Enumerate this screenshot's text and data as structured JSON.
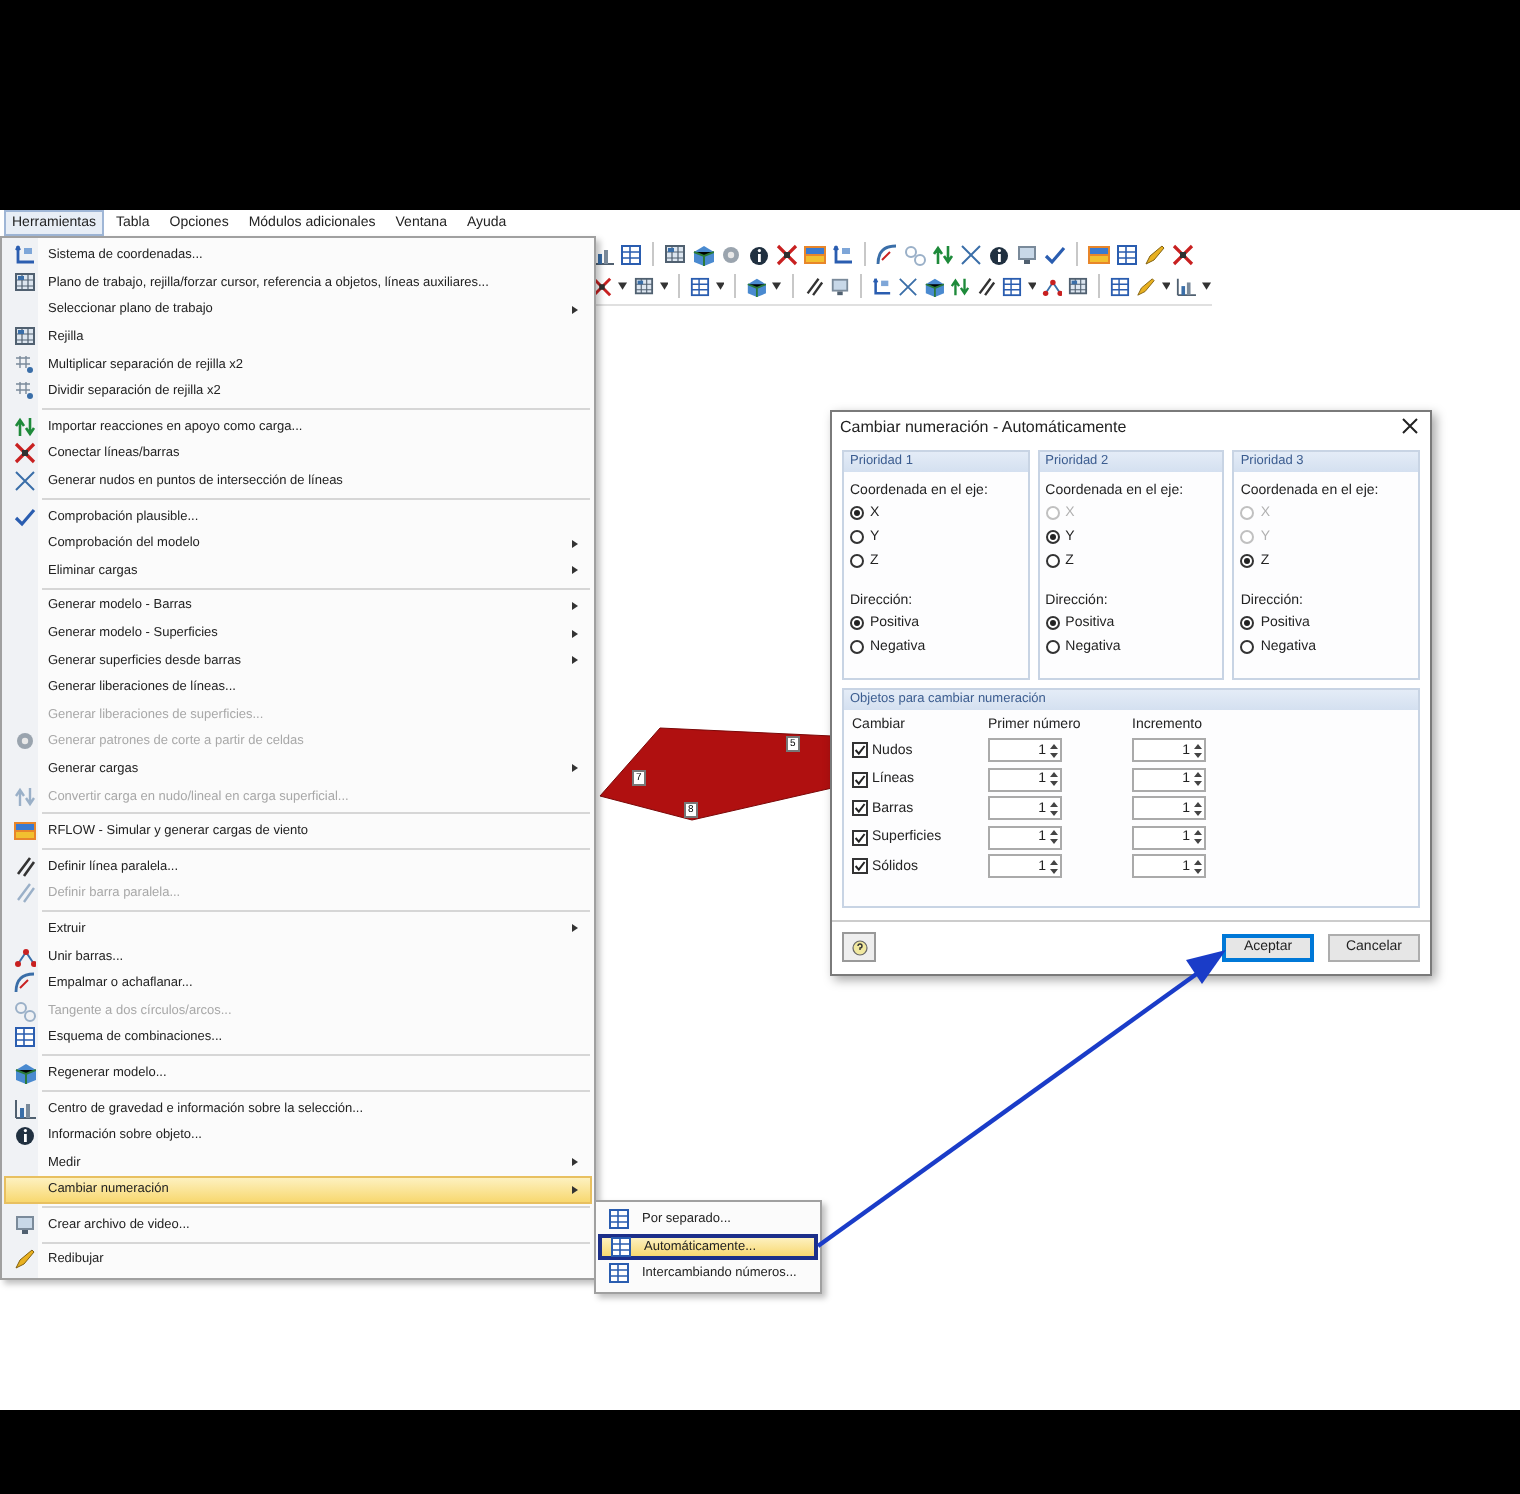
{
  "menu_bar": [
    {
      "label": "Herramientas",
      "selected": true
    },
    {
      "label": "Tabla",
      "selected": false
    },
    {
      "label": "Opciones",
      "selected": false
    },
    {
      "label": "Módulos adicionales",
      "selected": false
    },
    {
      "label": "Ventana",
      "selected": false
    },
    {
      "label": "Ayuda",
      "selected": false
    }
  ],
  "tools_menu": {
    "items": [
      {
        "kind": "item",
        "label": "Sistema de coordenadas...",
        "disabled": false,
        "submenu": false,
        "selected": false
      },
      {
        "kind": "item",
        "label": "Plano de trabajo, rejilla/forzar cursor, referencia a objetos, líneas auxiliares...",
        "disabled": false,
        "submenu": false,
        "selected": false
      },
      {
        "kind": "item",
        "label": "Seleccionar plano de trabajo",
        "disabled": false,
        "submenu": true,
        "selected": false
      },
      {
        "kind": "item",
        "label": "Rejilla",
        "disabled": false,
        "submenu": false,
        "selected": false
      },
      {
        "kind": "item",
        "label": "Multiplicar separación de rejilla x2",
        "disabled": false,
        "submenu": false,
        "selected": false
      },
      {
        "kind": "item",
        "label": "Dividir separación de rejilla x2",
        "disabled": false,
        "submenu": false,
        "selected": false
      },
      {
        "kind": "separator"
      },
      {
        "kind": "item",
        "label": "Importar reacciones en apoyo como carga...",
        "disabled": false,
        "submenu": false,
        "selected": false
      },
      {
        "kind": "item",
        "label": "Conectar líneas/barras",
        "disabled": false,
        "submenu": false,
        "selected": false
      },
      {
        "kind": "item",
        "label": "Generar nudos en puntos de intersección de líneas",
        "disabled": false,
        "submenu": false,
        "selected": false
      },
      {
        "kind": "separator"
      },
      {
        "kind": "item",
        "label": "Comprobación plausible...",
        "disabled": false,
        "submenu": false,
        "selected": false
      },
      {
        "kind": "item",
        "label": "Comprobación del modelo",
        "disabled": false,
        "submenu": true,
        "selected": false
      },
      {
        "kind": "item",
        "label": "Eliminar cargas",
        "disabled": false,
        "submenu": true,
        "selected": false
      },
      {
        "kind": "separator"
      },
      {
        "kind": "item",
        "label": "Generar modelo - Barras",
        "disabled": false,
        "submenu": true,
        "selected": false
      },
      {
        "kind": "item",
        "label": "Generar modelo - Superficies",
        "disabled": false,
        "submenu": true,
        "selected": false
      },
      {
        "kind": "item",
        "label": "Generar superficies desde barras",
        "disabled": false,
        "submenu": true,
        "selected": false
      },
      {
        "kind": "item",
        "label": "Generar liberaciones de líneas...",
        "disabled": false,
        "submenu": false,
        "selected": false
      },
      {
        "kind": "item",
        "label": "Generar liberaciones de superficies...",
        "disabled": true,
        "submenu": false,
        "selected": false
      },
      {
        "kind": "item",
        "label": "Generar patrones de corte a partir de celdas",
        "disabled": true,
        "submenu": false,
        "selected": false
      },
      {
        "kind": "item",
        "label": "Generar cargas",
        "disabled": false,
        "submenu": true,
        "selected": false
      },
      {
        "kind": "item",
        "label": "Convertir carga en nudo/lineal en carga superficial...",
        "disabled": true,
        "submenu": false,
        "selected": false
      },
      {
        "kind": "separator"
      },
      {
        "kind": "item",
        "label": "RFLOW - Simular y generar cargas de viento",
        "disabled": false,
        "submenu": false,
        "selected": false
      },
      {
        "kind": "separator"
      },
      {
        "kind": "item",
        "label": "Definir línea paralela...",
        "disabled": false,
        "submenu": false,
        "selected": false
      },
      {
        "kind": "item",
        "label": "Definir barra paralela...",
        "disabled": true,
        "submenu": false,
        "selected": false
      },
      {
        "kind": "separator"
      },
      {
        "kind": "item",
        "label": "Extruir",
        "disabled": false,
        "submenu": true,
        "selected": false
      },
      {
        "kind": "item",
        "label": "Unir barras...",
        "disabled": false,
        "submenu": false,
        "selected": false
      },
      {
        "kind": "item",
        "label": "Empalmar o achaflanar...",
        "disabled": false,
        "submenu": false,
        "selected": false
      },
      {
        "kind": "item",
        "label": "Tangente a dos círculos/arcos...",
        "disabled": true,
        "submenu": false,
        "selected": false
      },
      {
        "kind": "item",
        "label": "Esquema de combinaciones...",
        "disabled": false,
        "submenu": false,
        "selected": false
      },
      {
        "kind": "separator"
      },
      {
        "kind": "item",
        "label": "Regenerar modelo...",
        "disabled": false,
        "submenu": false,
        "selected": false
      },
      {
        "kind": "separator"
      },
      {
        "kind": "item",
        "label": "Centro de gravedad e información sobre la selección...",
        "disabled": false,
        "submenu": false,
        "selected": false
      },
      {
        "kind": "item",
        "label": "Información sobre objeto...",
        "disabled": false,
        "submenu": false,
        "selected": false
      },
      {
        "kind": "item",
        "label": "Medir",
        "disabled": false,
        "submenu": true,
        "selected": false
      },
      {
        "kind": "item",
        "label": "Cambiar numeración",
        "disabled": false,
        "submenu": true,
        "selected": true
      },
      {
        "kind": "separator"
      },
      {
        "kind": "item",
        "label": "Crear archivo de video...",
        "disabled": false,
        "submenu": false,
        "selected": false
      },
      {
        "kind": "separator"
      },
      {
        "kind": "item",
        "label": "Redibujar",
        "disabled": false,
        "submenu": false,
        "selected": false
      }
    ]
  },
  "submenu": {
    "items": [
      {
        "label": "Por separado...",
        "selected": false
      },
      {
        "label": "Automáticamente...",
        "selected": true
      },
      {
        "label": "Intercambiando números...",
        "selected": false
      }
    ]
  },
  "viewport": {
    "node_labels": [
      "7",
      "5",
      "8"
    ]
  },
  "dialog": {
    "title": "Cambiar numeración - Automáticamente",
    "priorities": [
      {
        "title": "Prioridad 1",
        "axis_label": "Coordenada en el eje:",
        "axes": [
          {
            "label": "X",
            "selected": true,
            "disabled": false
          },
          {
            "label": "Y",
            "selected": false,
            "disabled": false
          },
          {
            "label": "Z",
            "selected": false,
            "disabled": false
          }
        ],
        "direction_label": "Dirección:",
        "directions": [
          {
            "label": "Positiva",
            "selected": true
          },
          {
            "label": "Negativa",
            "selected": false
          }
        ]
      },
      {
        "title": "Prioridad 2",
        "axis_label": "Coordenada en el eje:",
        "axes": [
          {
            "label": "X",
            "selected": false,
            "disabled": true
          },
          {
            "label": "Y",
            "selected": true,
            "disabled": false
          },
          {
            "label": "Z",
            "selected": false,
            "disabled": false
          }
        ],
        "direction_label": "Dirección:",
        "directions": [
          {
            "label": "Positiva",
            "selected": true
          },
          {
            "label": "Negativa",
            "selected": false
          }
        ]
      },
      {
        "title": "Prioridad 3",
        "axis_label": "Coordenada en el eje:",
        "axes": [
          {
            "label": "X",
            "selected": false,
            "disabled": true
          },
          {
            "label": "Y",
            "selected": false,
            "disabled": true
          },
          {
            "label": "Z",
            "selected": true,
            "disabled": false
          }
        ],
        "direction_label": "Dirección:",
        "directions": [
          {
            "label": "Positiva",
            "selected": true
          },
          {
            "label": "Negativa",
            "selected": false
          }
        ]
      }
    ],
    "objects": {
      "title": "Objetos para cambiar numeración",
      "columns": [
        "Cambiar",
        "Primer número",
        "Incremento"
      ],
      "rows": [
        {
          "label": "Nudos",
          "checked": true,
          "first_number": "1",
          "increment": "1"
        },
        {
          "label": "Líneas",
          "checked": true,
          "first_number": "1",
          "increment": "1"
        },
        {
          "label": "Barras",
          "checked": true,
          "first_number": "1",
          "increment": "1"
        },
        {
          "label": "Superficies",
          "checked": true,
          "first_number": "1",
          "increment": "1"
        },
        {
          "label": "Sólidos",
          "checked": true,
          "first_number": "1",
          "increment": "1"
        }
      ]
    },
    "buttons": [
      {
        "label": "Aceptar",
        "default": true
      },
      {
        "label": "Cancelar",
        "default": false
      }
    ]
  }
}
